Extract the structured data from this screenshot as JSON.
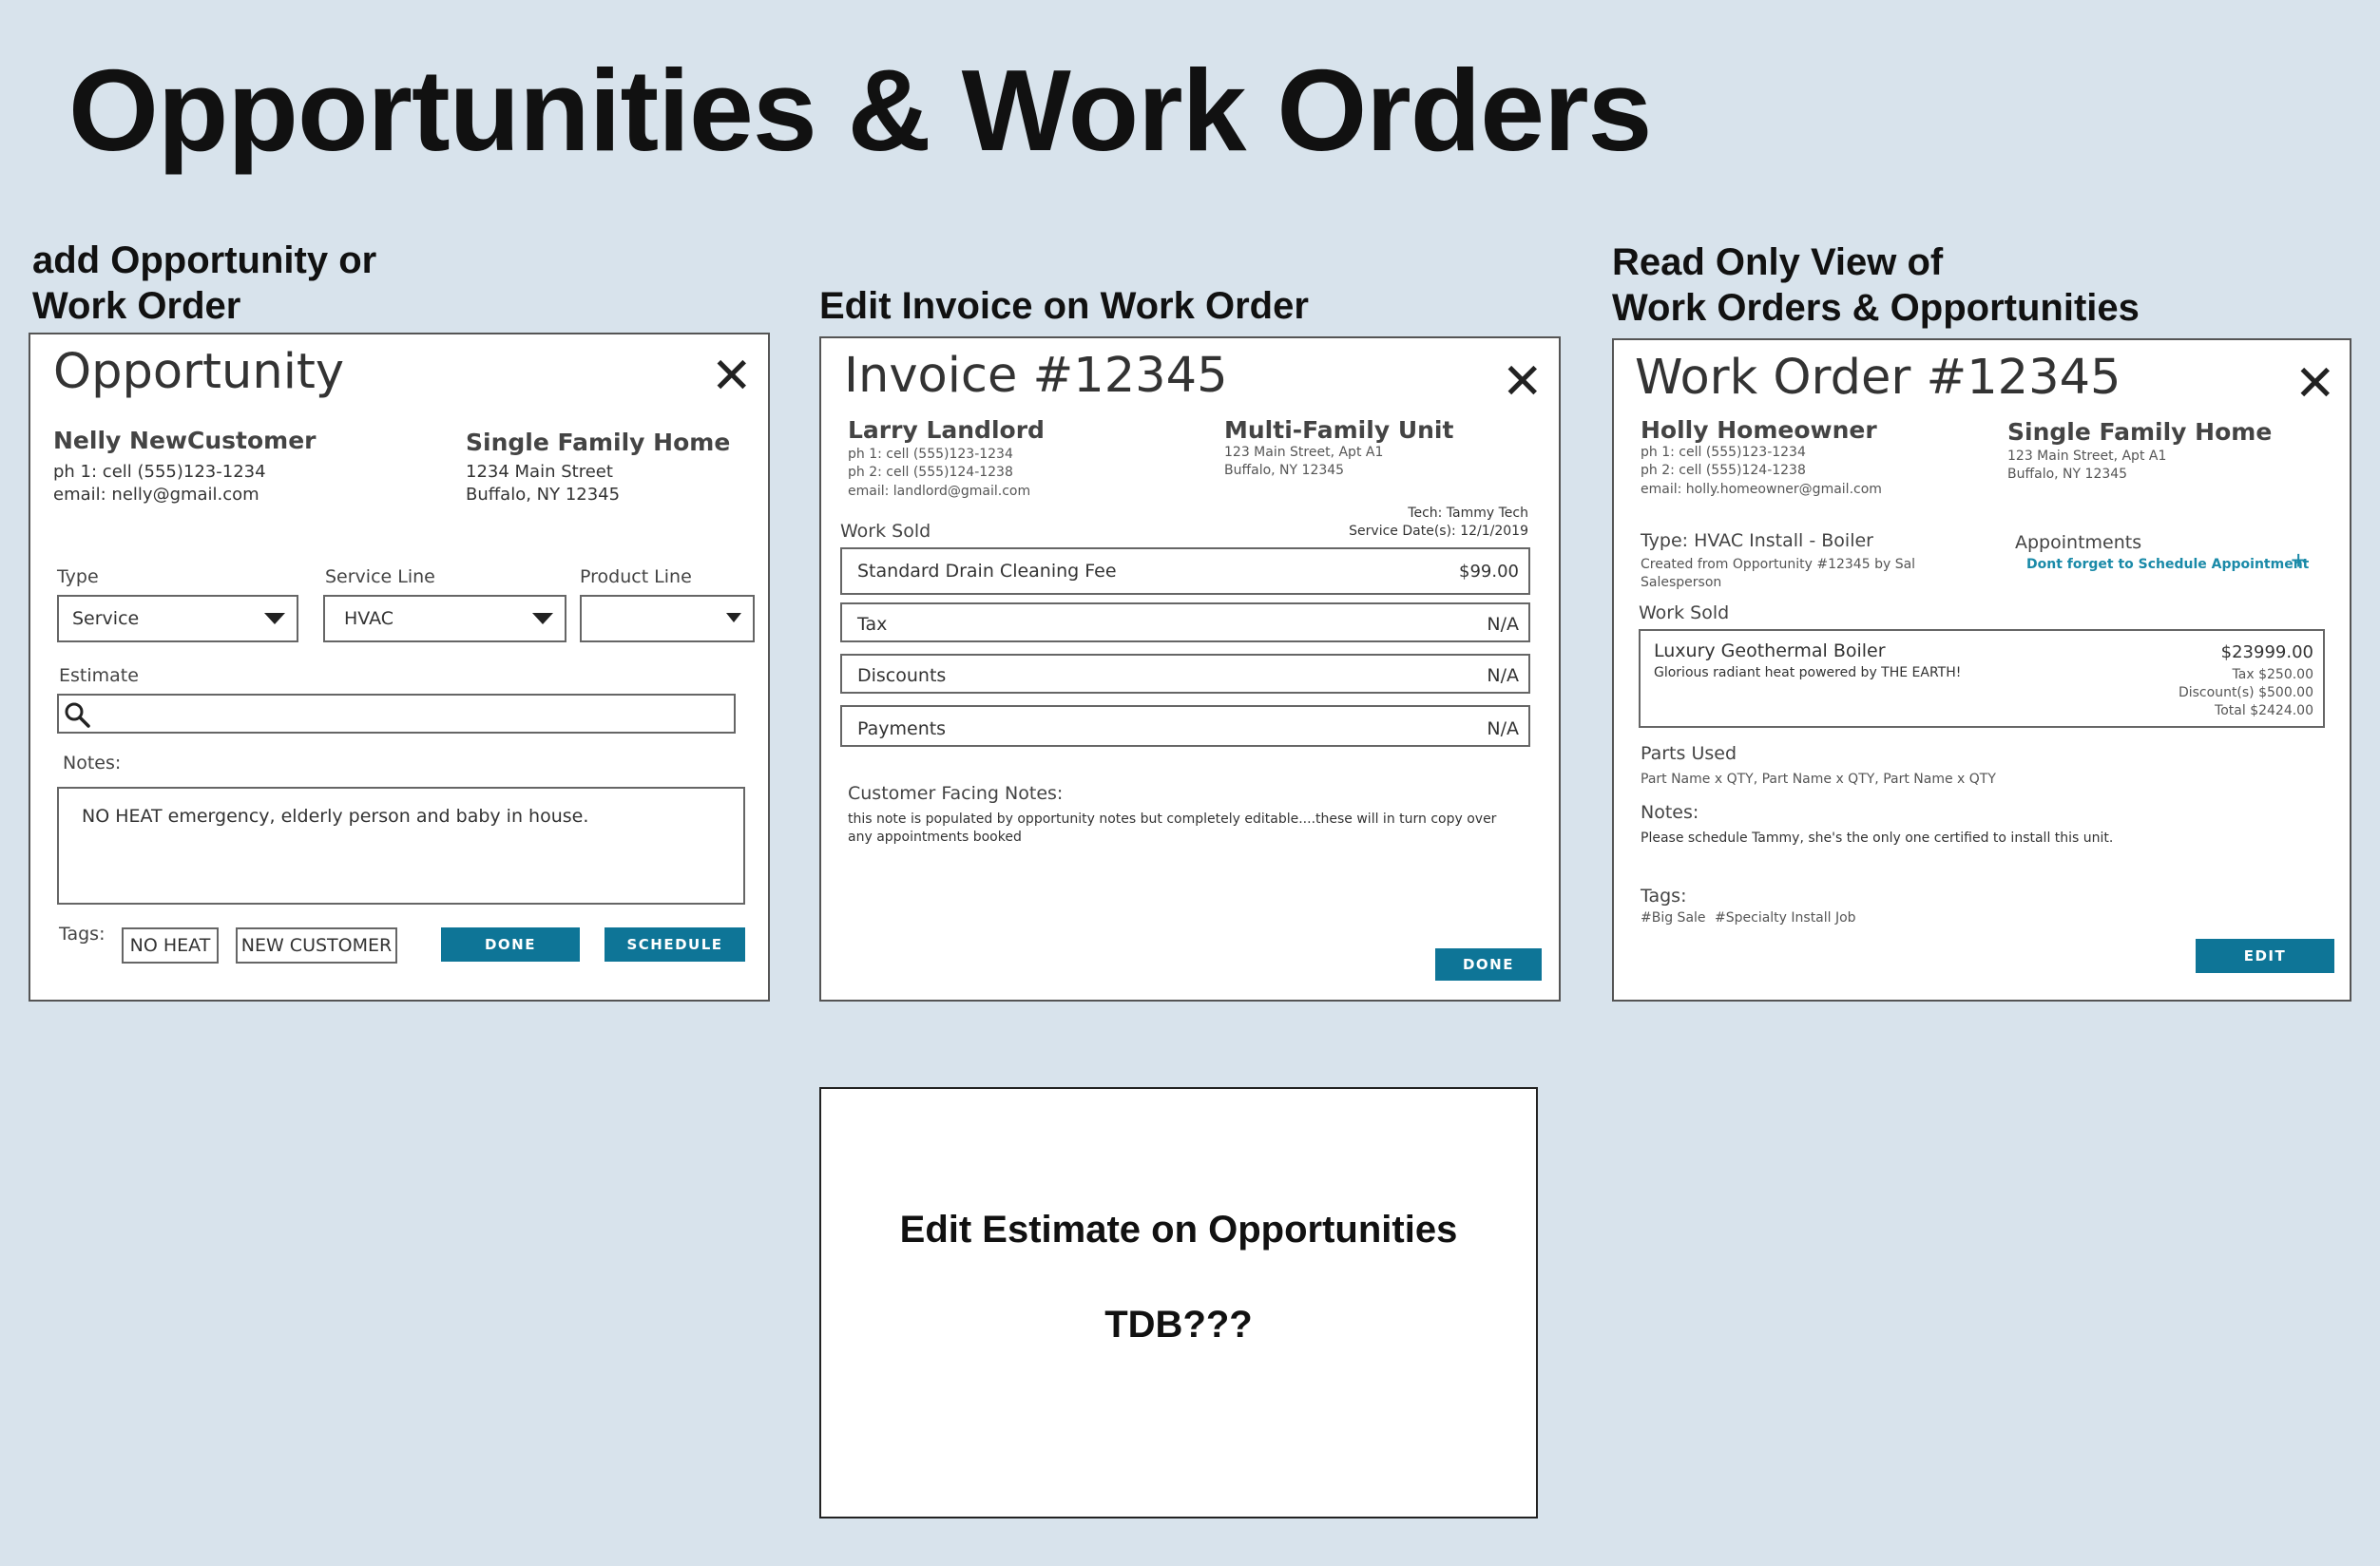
{
  "page_title": "Opportunities & Work Orders",
  "sections": {
    "add": [
      "add Opportunity or",
      "Work Order"
    ],
    "invoice": "Edit Invoice on Work Order",
    "readonly": [
      "Read Only View of",
      "Work Orders & Opportunities"
    ]
  },
  "opportunity": {
    "title": "Opportunity",
    "close_icon": "close-icon",
    "customer": {
      "name": "Nelly NewCustomer",
      "phone": "ph 1: cell (555)123-1234",
      "email": "email: nelly@gmail.com"
    },
    "property": {
      "type": "Single Family Home",
      "street": "1234 Main Street",
      "city": "Buffalo, NY 12345"
    },
    "type_label": "Type",
    "type_value": "Service",
    "service_line_label": "Service Line",
    "service_line_value": "HVAC",
    "product_line_label": "Product Line",
    "product_line_value": "",
    "estimate_label": "Estimate",
    "estimate_value": "",
    "notes_label": "Notes:",
    "notes_value": "NO HEAT emergency, elderly person and baby in house.",
    "tags_label": "Tags:",
    "tags": [
      "NO HEAT",
      "NEW CUSTOMER"
    ],
    "done_label": "DONE",
    "schedule_label": "SCHEDULE"
  },
  "invoice": {
    "title": "Invoice #12345",
    "customer": {
      "name": "Larry Landlord",
      "phone1": "ph 1: cell (555)123-1234",
      "phone2": "ph 2: cell (555)124-1238",
      "email": "email: landlord@gmail.com"
    },
    "property": {
      "type": "Multi-Family Unit",
      "street": "123 Main Street, Apt A1",
      "city": "Buffalo, NY 12345"
    },
    "tech": "Tech: Tammy Tech",
    "service_date": "Service Date(s): 12/1/2019",
    "work_sold_label": "Work Sold",
    "lines": [
      {
        "label": "Standard Drain Cleaning Fee",
        "value": "$99.00"
      },
      {
        "label": "Tax",
        "value": "N/A"
      },
      {
        "label": "Discounts",
        "value": "N/A"
      },
      {
        "label": "Payments",
        "value": "N/A"
      }
    ],
    "notes_label": "Customer Facing Notes:",
    "notes_line1": "this note is populated by opportunity notes but completely editable....these will in turn copy over",
    "notes_line2": "any appointments booked",
    "done_label": "DONE"
  },
  "work_order": {
    "title": "Work Order #12345",
    "customer": {
      "name": "Holly Homeowner",
      "phone1": "ph 1: cell (555)123-1234",
      "phone2": "ph 2: cell (555)124-1238",
      "email": "email: holly.homeowner@gmail.com"
    },
    "property": {
      "type": "Single Family Home",
      "street": "123 Main Street, Apt A1",
      "city": "Buffalo, NY 12345"
    },
    "type_line": "Type: HVAC Install - Boiler",
    "created_line1": "Created from Opportunity #12345 by  Sal",
    "created_line2": "Salesperson",
    "appointments_label": "Appointments",
    "appointments_link": "Dont forget to Schedule Appointment",
    "add_icon": "plus-icon",
    "work_sold_label": "Work Sold",
    "item_name": "Luxury Geothermal Boiler",
    "item_desc": "Glorious radiant heat powered by THE EARTH!",
    "item_price": "$23999.00",
    "item_tax": "Tax  $250.00",
    "item_discount": "Discount(s) $500.00",
    "item_total": "Total $2424.00",
    "parts_label": "Parts Used",
    "parts_value": "Part Name x QTY, Part Name x QTY, Part Name x QTY",
    "notes_label": "Notes:",
    "notes_value": "Please schedule Tammy, she's the only one certified to install this unit.",
    "tags_label": "Tags:",
    "tags": [
      "#Big Sale",
      "#Specialty Install Job"
    ],
    "edit_label": "EDIT"
  },
  "estimate_panel": {
    "title": "Edit Estimate on Opportunities",
    "subtitle": "TDB???"
  },
  "colors": {
    "background": "#d8e3ec",
    "accent": "#0e7597",
    "link": "#1a8aa8"
  }
}
